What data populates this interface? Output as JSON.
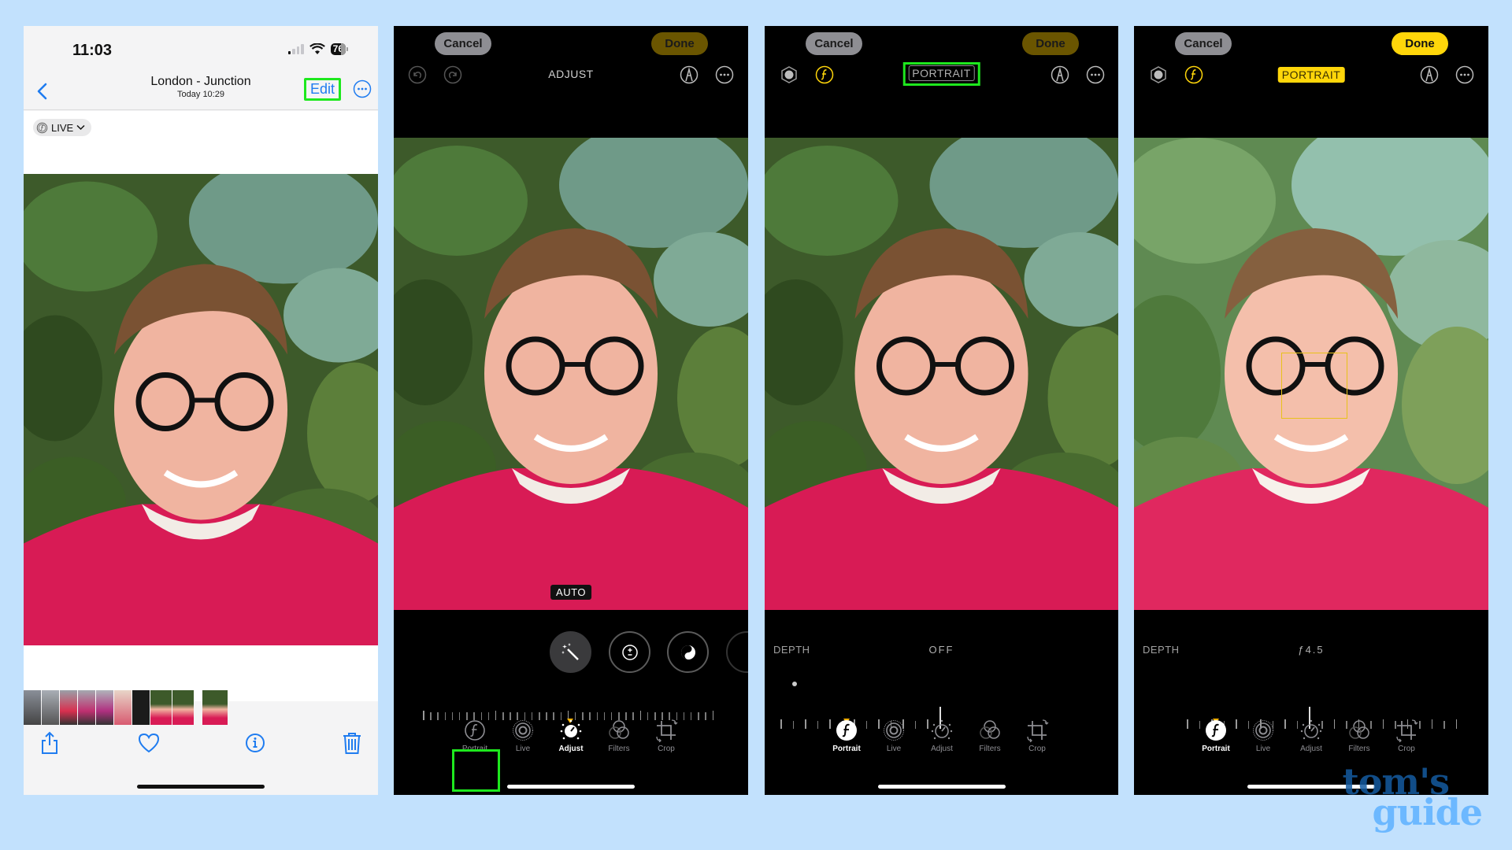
{
  "colors": {
    "background": "#c2e1fd",
    "highlight_outline": "#1ee81e",
    "ios_blue": "#1f7cf0",
    "accent_yellow": "#ffd60a",
    "done_dim": "#6a5500",
    "indicator_orange": "#ffb300",
    "sweater_red": "#d81b55"
  },
  "panel1": {
    "status": {
      "time": "11:03",
      "battery": "76"
    },
    "nav": {
      "title": "London - Junction",
      "subtitle": "Today  10:29",
      "edit_label": "Edit"
    },
    "live_badge": "LIVE",
    "icons": {
      "back": "chevron-left-icon",
      "more": "ellipsis-circle-icon",
      "live": "live-photo-icon",
      "share": "share-icon",
      "favorite": "heart-icon",
      "info": "info-icon",
      "delete": "trash-icon"
    },
    "filmstrip_count": 10
  },
  "panel2": {
    "cancel_label": "Cancel",
    "done_label": "Done",
    "mode_label": "ADJUST",
    "auto_label": "AUTO",
    "adjust_tools": [
      "auto-enhance",
      "exposure",
      "brilliance"
    ],
    "tabs": [
      {
        "label": "Portrait",
        "icon": "aperture-f-icon"
      },
      {
        "label": "Live",
        "icon": "live-icon"
      },
      {
        "label": "Adjust",
        "icon": "adjust-dial-icon"
      },
      {
        "label": "Filters",
        "icon": "filters-icon"
      },
      {
        "label": "Crop",
        "icon": "crop-icon"
      }
    ],
    "active_tab": "Adjust",
    "highlighted_tab": "Portrait"
  },
  "panel3": {
    "cancel_label": "Cancel",
    "done_label": "Done",
    "mode_label": "PORTRAIT",
    "depth_label": "DEPTH",
    "depth_value": "OFF",
    "tabs": [
      {
        "label": "Portrait"
      },
      {
        "label": "Live"
      },
      {
        "label": "Adjust"
      },
      {
        "label": "Filters"
      },
      {
        "label": "Crop"
      }
    ],
    "active_tab": "Portrait"
  },
  "panel4": {
    "cancel_label": "Cancel",
    "done_label": "Done",
    "mode_label": "PORTRAIT",
    "depth_label": "DEPTH",
    "depth_value": "ƒ4.5",
    "tabs": [
      {
        "label": "Portrait"
      },
      {
        "label": "Live"
      },
      {
        "label": "Adjust"
      },
      {
        "label": "Filters"
      },
      {
        "label": "Crop"
      }
    ],
    "active_tab": "Portrait"
  },
  "watermark": {
    "line1": "tom's",
    "line2": "guide"
  }
}
